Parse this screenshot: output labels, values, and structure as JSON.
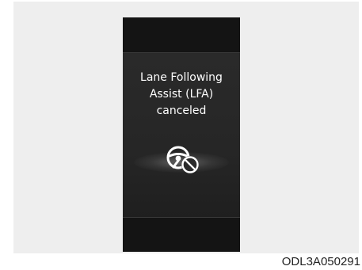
{
  "message": {
    "line1": "Lane Following",
    "line2": "Assist (LFA)",
    "line3": "canceled"
  },
  "icon": "steering-wheel-canceled-icon",
  "image_code": "ODL3A050291",
  "colors": {
    "display_bg": "#111111",
    "panel_bg": "#262626",
    "text": "#ffffff",
    "frame_bg": "#eeeeee"
  }
}
